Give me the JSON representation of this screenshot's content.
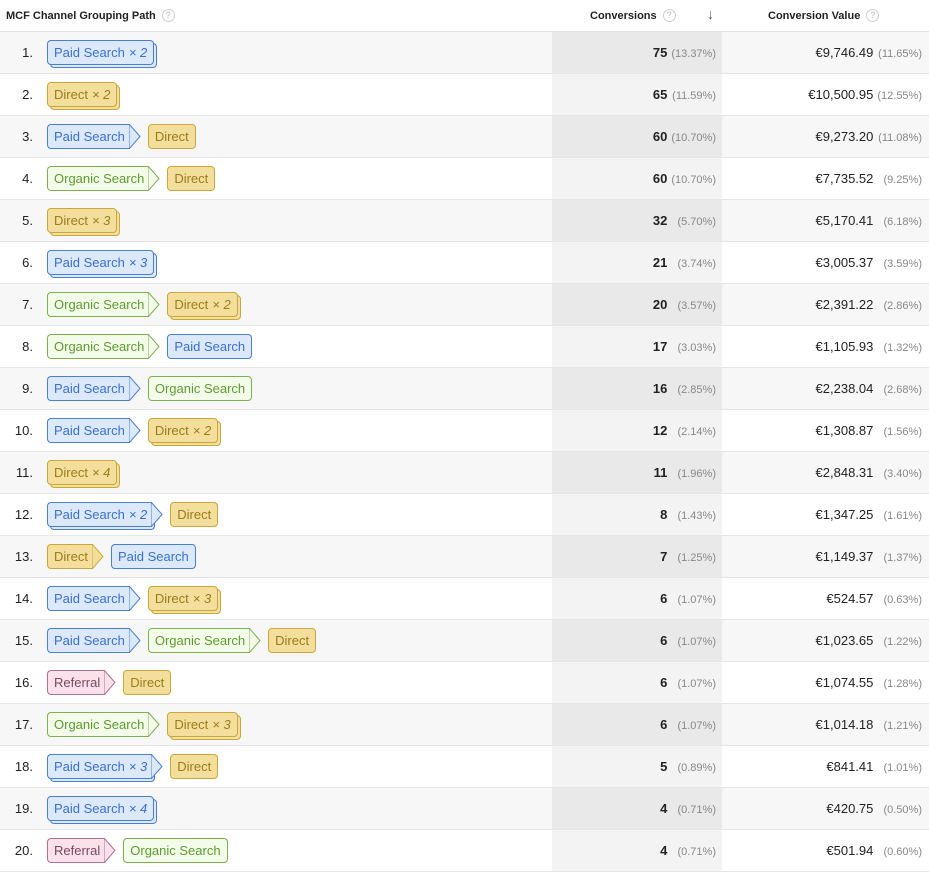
{
  "header": {
    "path_label": "MCF Channel Grouping Path",
    "conversions_label": "Conversions",
    "value_label": "Conversion Value",
    "help_icon": "?",
    "sort_icon": "↓"
  },
  "colors": {
    "paid_search": "#4a7fd6",
    "direct": "#c8a83c",
    "organic_search": "#7fae52",
    "referral": "#b07090",
    "sorted_column_bg": "#e9e9e9"
  },
  "rows": [
    {
      "index": "1.",
      "path": [
        {
          "channel": "Paid Search",
          "type": "paid",
          "mult": "× 2"
        }
      ],
      "conversions": "75",
      "conv_pct": "(13.37%)",
      "value": "€9,746.49",
      "value_pct": "(11.65%)"
    },
    {
      "index": "2.",
      "path": [
        {
          "channel": "Direct",
          "type": "direct",
          "mult": "× 2"
        }
      ],
      "conversions": "65",
      "conv_pct": "(11.59%)",
      "value": "€10,500.95",
      "value_pct": "(12.55%)"
    },
    {
      "index": "3.",
      "path": [
        {
          "channel": "Paid Search",
          "type": "paid",
          "mult": ""
        },
        {
          "channel": "Direct",
          "type": "direct",
          "mult": ""
        }
      ],
      "conversions": "60",
      "conv_pct": "(10.70%)",
      "value": "€9,273.20",
      "value_pct": "(11.08%)"
    },
    {
      "index": "4.",
      "path": [
        {
          "channel": "Organic Search",
          "type": "organic",
          "mult": ""
        },
        {
          "channel": "Direct",
          "type": "direct",
          "mult": ""
        }
      ],
      "conversions": "60",
      "conv_pct": "(10.70%)",
      "value": "€7,735.52",
      "value_pct": "(9.25%)"
    },
    {
      "index": "5.",
      "path": [
        {
          "channel": "Direct",
          "type": "direct",
          "mult": "× 3"
        }
      ],
      "conversions": "32",
      "conv_pct": "(5.70%)",
      "value": "€5,170.41",
      "value_pct": "(6.18%)"
    },
    {
      "index": "6.",
      "path": [
        {
          "channel": "Paid Search",
          "type": "paid",
          "mult": "× 3"
        }
      ],
      "conversions": "21",
      "conv_pct": "(3.74%)",
      "value": "€3,005.37",
      "value_pct": "(3.59%)"
    },
    {
      "index": "7.",
      "path": [
        {
          "channel": "Organic Search",
          "type": "organic",
          "mult": ""
        },
        {
          "channel": "Direct",
          "type": "direct",
          "mult": "× 2"
        }
      ],
      "conversions": "20",
      "conv_pct": "(3.57%)",
      "value": "€2,391.22",
      "value_pct": "(2.86%)"
    },
    {
      "index": "8.",
      "path": [
        {
          "channel": "Organic Search",
          "type": "organic",
          "mult": ""
        },
        {
          "channel": "Paid Search",
          "type": "paid",
          "mult": ""
        }
      ],
      "conversions": "17",
      "conv_pct": "(3.03%)",
      "value": "€1,105.93",
      "value_pct": "(1.32%)"
    },
    {
      "index": "9.",
      "path": [
        {
          "channel": "Paid Search",
          "type": "paid",
          "mult": ""
        },
        {
          "channel": "Organic Search",
          "type": "organic",
          "mult": ""
        }
      ],
      "conversions": "16",
      "conv_pct": "(2.85%)",
      "value": "€2,238.04",
      "value_pct": "(2.68%)"
    },
    {
      "index": "10.",
      "path": [
        {
          "channel": "Paid Search",
          "type": "paid",
          "mult": ""
        },
        {
          "channel": "Direct",
          "type": "direct",
          "mult": "× 2"
        }
      ],
      "conversions": "12",
      "conv_pct": "(2.14%)",
      "value": "€1,308.87",
      "value_pct": "(1.56%)"
    },
    {
      "index": "11.",
      "path": [
        {
          "channel": "Direct",
          "type": "direct",
          "mult": "× 4"
        }
      ],
      "conversions": "11",
      "conv_pct": "(1.96%)",
      "value": "€2,848.31",
      "value_pct": "(3.40%)"
    },
    {
      "index": "12.",
      "path": [
        {
          "channel": "Paid Search",
          "type": "paid",
          "mult": "× 2"
        },
        {
          "channel": "Direct",
          "type": "direct",
          "mult": ""
        }
      ],
      "conversions": "8",
      "conv_pct": "(1.43%)",
      "value": "€1,347.25",
      "value_pct": "(1.61%)"
    },
    {
      "index": "13.",
      "path": [
        {
          "channel": "Direct",
          "type": "direct",
          "mult": ""
        },
        {
          "channel": "Paid Search",
          "type": "paid",
          "mult": ""
        }
      ],
      "conversions": "7",
      "conv_pct": "(1.25%)",
      "value": "€1,149.37",
      "value_pct": "(1.37%)"
    },
    {
      "index": "14.",
      "path": [
        {
          "channel": "Paid Search",
          "type": "paid",
          "mult": ""
        },
        {
          "channel": "Direct",
          "type": "direct",
          "mult": "× 3"
        }
      ],
      "conversions": "6",
      "conv_pct": "(1.07%)",
      "value": "€524.57",
      "value_pct": "(0.63%)"
    },
    {
      "index": "15.",
      "path": [
        {
          "channel": "Paid Search",
          "type": "paid",
          "mult": ""
        },
        {
          "channel": "Organic Search",
          "type": "organic",
          "mult": ""
        },
        {
          "channel": "Direct",
          "type": "direct",
          "mult": ""
        }
      ],
      "conversions": "6",
      "conv_pct": "(1.07%)",
      "value": "€1,023.65",
      "value_pct": "(1.22%)"
    },
    {
      "index": "16.",
      "path": [
        {
          "channel": "Referral",
          "type": "referral",
          "mult": ""
        },
        {
          "channel": "Direct",
          "type": "direct",
          "mult": ""
        }
      ],
      "conversions": "6",
      "conv_pct": "(1.07%)",
      "value": "€1,074.55",
      "value_pct": "(1.28%)"
    },
    {
      "index": "17.",
      "path": [
        {
          "channel": "Organic Search",
          "type": "organic",
          "mult": ""
        },
        {
          "channel": "Direct",
          "type": "direct",
          "mult": "× 3"
        }
      ],
      "conversions": "6",
      "conv_pct": "(1.07%)",
      "value": "€1,014.18",
      "value_pct": "(1.21%)"
    },
    {
      "index": "18.",
      "path": [
        {
          "channel": "Paid Search",
          "type": "paid",
          "mult": "× 3"
        },
        {
          "channel": "Direct",
          "type": "direct",
          "mult": ""
        }
      ],
      "conversions": "5",
      "conv_pct": "(0.89%)",
      "value": "€841.41",
      "value_pct": "(1.01%)"
    },
    {
      "index": "19.",
      "path": [
        {
          "channel": "Paid Search",
          "type": "paid",
          "mult": "× 4"
        }
      ],
      "conversions": "4",
      "conv_pct": "(0.71%)",
      "value": "€420.75",
      "value_pct": "(0.50%)"
    },
    {
      "index": "20.",
      "path": [
        {
          "channel": "Referral",
          "type": "referral",
          "mult": ""
        },
        {
          "channel": "Organic Search",
          "type": "organic",
          "mult": ""
        }
      ],
      "conversions": "4",
      "conv_pct": "(0.71%)",
      "value": "€501.94",
      "value_pct": "(0.60%)"
    }
  ]
}
